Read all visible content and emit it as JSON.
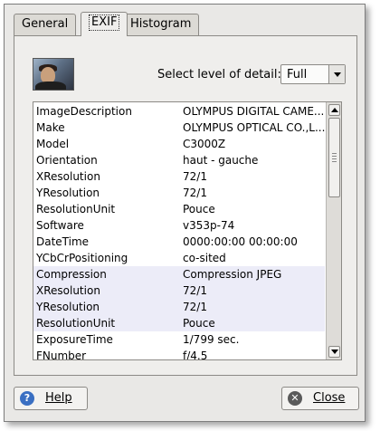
{
  "tabs": [
    {
      "label": "General"
    },
    {
      "label": "EXIF"
    },
    {
      "label": "Histogram"
    }
  ],
  "detail": {
    "label": "Select level of detail:",
    "selected": "Full"
  },
  "exif_rows": [
    {
      "key": "ImageDescription",
      "value": "OLYMPUS DIGITAL CAME..."
    },
    {
      "key": "Make",
      "value": "OLYMPUS OPTICAL CO.,L..."
    },
    {
      "key": "Model",
      "value": "C3000Z"
    },
    {
      "key": "Orientation",
      "value": "haut - gauche"
    },
    {
      "key": "XResolution",
      "value": "72/1"
    },
    {
      "key": "YResolution",
      "value": "72/1"
    },
    {
      "key": "ResolutionUnit",
      "value": "Pouce"
    },
    {
      "key": "Software",
      "value": "v353p-74"
    },
    {
      "key": "DateTime",
      "value": "0000:00:00 00:00:00"
    },
    {
      "key": "YCbCrPositioning",
      "value": "co-sited"
    },
    {
      "key": "Compression",
      "value": "Compression JPEG"
    },
    {
      "key": "XResolution",
      "value": "72/1"
    },
    {
      "key": "YResolution",
      "value": "72/1"
    },
    {
      "key": "ResolutionUnit",
      "value": "Pouce"
    },
    {
      "key": "ExposureTime",
      "value": "1/799 sec."
    },
    {
      "key": "FNumber",
      "value": "f/4.5"
    }
  ],
  "buttons": {
    "help": "Help",
    "close": "Close"
  },
  "icons": {
    "help": "help-icon",
    "close": "close-icon"
  }
}
